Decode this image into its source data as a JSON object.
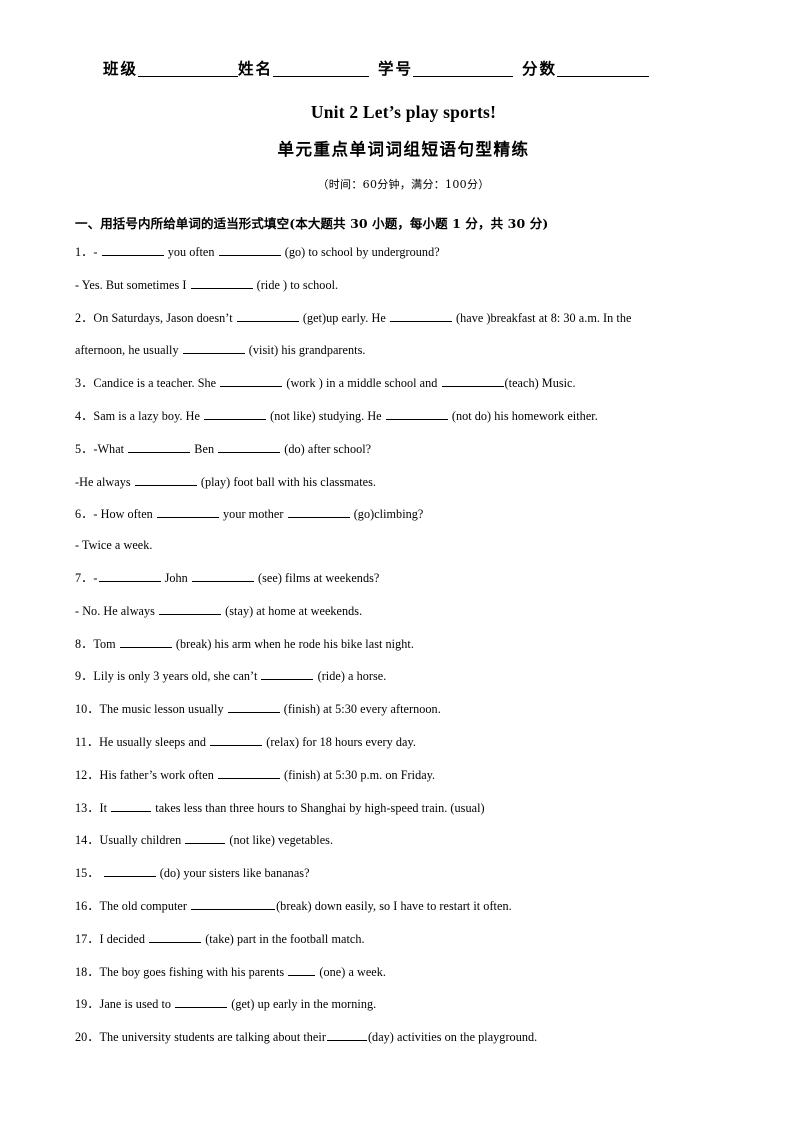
{
  "header": {
    "fields": [
      {
        "label": "班级",
        "rule": "r1"
      },
      {
        "label": "姓名",
        "rule": "r2"
      },
      {
        "label": "学号",
        "rule": "r3"
      },
      {
        "label": "分数",
        "rule": "r4"
      }
    ]
  },
  "titles": {
    "english": "Unit 2 Let’s play sports!",
    "chinese": "单元重点单词词组短语句型精练",
    "exam_info": "（时间：60分钟，满分：100分）"
  },
  "section": {
    "heading": "一、用括号内所给单词的适当形式填空(本大题共 30 小题，每小题 1 分，共 30 分)"
  },
  "questions": [
    {
      "num": "1．",
      "parts": [
        {
          "t": "- "
        },
        {
          "blank": "b-lg"
        },
        {
          "t": " you often "
        },
        {
          "blank": "b-lg"
        },
        {
          "t": " (go) to school by underground?"
        }
      ]
    },
    {
      "cont": true,
      "parts": [
        {
          "t": "- Yes. But sometimes I "
        },
        {
          "blank": "b-lg"
        },
        {
          "t": " (ride ) to school."
        }
      ]
    },
    {
      "num": "2．",
      "parts": [
        {
          "t": "On Saturdays, Jason doesn’t "
        },
        {
          "blank": "b-lg"
        },
        {
          "t": " (get)up early. He "
        },
        {
          "blank": "b-lg"
        },
        {
          "t": " (have )breakfast at 8: 30 a.m. In the"
        }
      ]
    },
    {
      "cont": true,
      "parts": [
        {
          "t": "afternoon, he usually "
        },
        {
          "blank": "b-lg"
        },
        {
          "t": " (visit) his grandparents."
        }
      ]
    },
    {
      "num": "3．",
      "parts": [
        {
          "t": "Candice is a teacher. She "
        },
        {
          "blank": "b-lg"
        },
        {
          "t": " (work ) in a middle school and "
        },
        {
          "blank": "b-lg"
        },
        {
          "t": "(teach) Music."
        }
      ]
    },
    {
      "num": "4．",
      "parts": [
        {
          "t": "Sam is a lazy boy. He "
        },
        {
          "blank": "b-lg"
        },
        {
          "t": " (not like) studying. He "
        },
        {
          "blank": "b-lg"
        },
        {
          "t": " (not do) his homework either."
        }
      ]
    },
    {
      "num": "5．",
      "parts": [
        {
          "t": "-What "
        },
        {
          "blank": "b-lg"
        },
        {
          "t": " Ben "
        },
        {
          "blank": "b-lg"
        },
        {
          "t": " (do) after school?"
        }
      ]
    },
    {
      "cont": true,
      "parts": [
        {
          "t": "-He always "
        },
        {
          "blank": "b-lg"
        },
        {
          "t": " (play) foot ball with his classmates."
        }
      ]
    },
    {
      "num": "6．",
      "parts": [
        {
          "t": "- How often "
        },
        {
          "blank": "b-lg"
        },
        {
          "t": " your mother "
        },
        {
          "blank": "b-lg"
        },
        {
          "t": " (go)climbing?"
        }
      ]
    },
    {
      "cont": true,
      "parts": [
        {
          "t": "- Twice a week."
        }
      ]
    },
    {
      "num": "7．",
      "parts": [
        {
          "t": "-"
        },
        {
          "blank": "b-lg"
        },
        {
          "t": " John "
        },
        {
          "blank": "b-lg"
        },
        {
          "t": " (see) films at weekends?"
        }
      ]
    },
    {
      "cont": true,
      "parts": [
        {
          "t": "- No. He always "
        },
        {
          "blank": "b-lg"
        },
        {
          "t": "   (stay) at home at weekends."
        }
      ]
    },
    {
      "num": "8．",
      "parts": [
        {
          "t": "Tom "
        },
        {
          "blank": "b-md"
        },
        {
          "t": " (break) his arm when he rode his bike last night."
        }
      ]
    },
    {
      "num": "9．",
      "parts": [
        {
          "t": "Lily is only 3 years old, she can’t "
        },
        {
          "blank": "b-md"
        },
        {
          "t": " (ride) a horse."
        }
      ]
    },
    {
      "num": "10．",
      "parts": [
        {
          "t": "The music lesson usually "
        },
        {
          "blank": "b-md"
        },
        {
          "t": " (finish) at 5:30 every afternoon."
        }
      ]
    },
    {
      "num": "11．",
      "parts": [
        {
          "t": "He usually sleeps and "
        },
        {
          "blank": "b-md"
        },
        {
          "t": " (relax) for 18 hours every day."
        }
      ]
    },
    {
      "num": "12．",
      "parts": [
        {
          "t": "His father’s work often "
        },
        {
          "blank": "b-lg"
        },
        {
          "t": " (finish) at 5:30 p.m. on Friday."
        }
      ]
    },
    {
      "num": "13．",
      "parts": [
        {
          "t": "It "
        },
        {
          "blank": "b-sm"
        },
        {
          "t": " takes less than three hours to Shanghai by high-speed train. (usual)"
        }
      ]
    },
    {
      "num": "14．",
      "parts": [
        {
          "t": "Usually children "
        },
        {
          "blank": "b-sm"
        },
        {
          "t": " (not like) vegetables."
        }
      ]
    },
    {
      "num": "15．",
      "parts": [
        {
          "t": " "
        },
        {
          "blank": "b-md"
        },
        {
          "t": " (do) your sisters like bananas?"
        }
      ]
    },
    {
      "num": "16．",
      "parts": [
        {
          "t": "The old computer "
        },
        {
          "blank": "b-xl"
        },
        {
          "t": "(break) down easily, so I have to restart it often."
        }
      ]
    },
    {
      "num": "17．",
      "parts": [
        {
          "t": "I decided "
        },
        {
          "blank": "b-md"
        },
        {
          "t": " (take) part in the football match."
        }
      ]
    },
    {
      "num": "18．",
      "parts": [
        {
          "t": "The boy goes fishing with his parents "
        },
        {
          "blank": "b-xs"
        },
        {
          "t": " (one) a week."
        }
      ]
    },
    {
      "num": "19．",
      "parts": [
        {
          "t": "Jane is used to "
        },
        {
          "blank": "b-md"
        },
        {
          "t": " (get) up early in the morning."
        }
      ]
    },
    {
      "num": "20．",
      "parts": [
        {
          "t": "The university students are talking about their"
        },
        {
          "blank": "b-sm"
        },
        {
          "t": "(day) activities on the playground."
        }
      ]
    }
  ]
}
